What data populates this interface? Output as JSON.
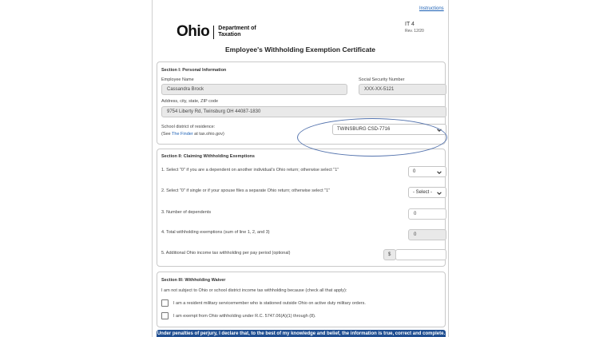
{
  "header": {
    "instructions_link": "Instructions",
    "logo_word": "Ohio",
    "dept_line1": "Department of",
    "dept_line2": "Taxation",
    "form_id": "IT 4",
    "form_rev": "Rev. 12/20",
    "title": "Employee's Withholding Exemption Certificate"
  },
  "section1": {
    "heading": "Section I: Personal Information",
    "name_label": "Employee Name",
    "name_value": "Cassandra  Brock",
    "ssn_label": "Social Security Number",
    "ssn_value": "XXX-XX-5121",
    "address_label": "Address, city, state, ZIP code",
    "address_value": "9754 Liberty Rd, Twinsburg OH 44087-1830",
    "district_label": "School district of residence:",
    "district_hint_prefix": "(See ",
    "district_hint_link": "The Finder",
    "district_hint_suffix": " at tax.ohio.gov)",
    "district_value": "TWINSBURG CSD-7716"
  },
  "section2": {
    "heading": "Section II: Claiming Withholding Exemptions",
    "line1_label": "1. Select \"0\" if you are a dependent on another individual's Ohio return; otherwise select \"1\"",
    "line1_value": "0",
    "line2_label": "2. Select \"0\" if single or if your spouse files a separate Ohio return; otherwise select \"1\"",
    "line2_value": "- Select -",
    "line3_label": "3. Number of dependents",
    "line3_value": "0",
    "line4_label": "4. Total withholding exemptions (sum of line 1, 2, and 3)",
    "line4_value": "0",
    "line5_label": "5. Additional Ohio income tax withholding per pay period (optional)",
    "currency_symbol": "$",
    "line5_value": ""
  },
  "section3": {
    "heading": "Section III: Withholding Waiver",
    "intro": "I am not subject to Ohio or school district income tax withholding because (check all that apply):",
    "option1": "I am a resident military servicemember who is stationed outside Ohio on active duty military orders.",
    "option2": "I am exempt from Ohio withholding under R.C. 5747.06(A)(1) through (8)."
  },
  "footer": {
    "perjury_banner": "Under penalties of perjury, I declare that, to the best of my knowledge and belief, the information is true, correct and complete."
  },
  "colors": {
    "banner": "#1f4e91",
    "annotation_ring": "#5574ae",
    "link": "#1a5fb4"
  }
}
